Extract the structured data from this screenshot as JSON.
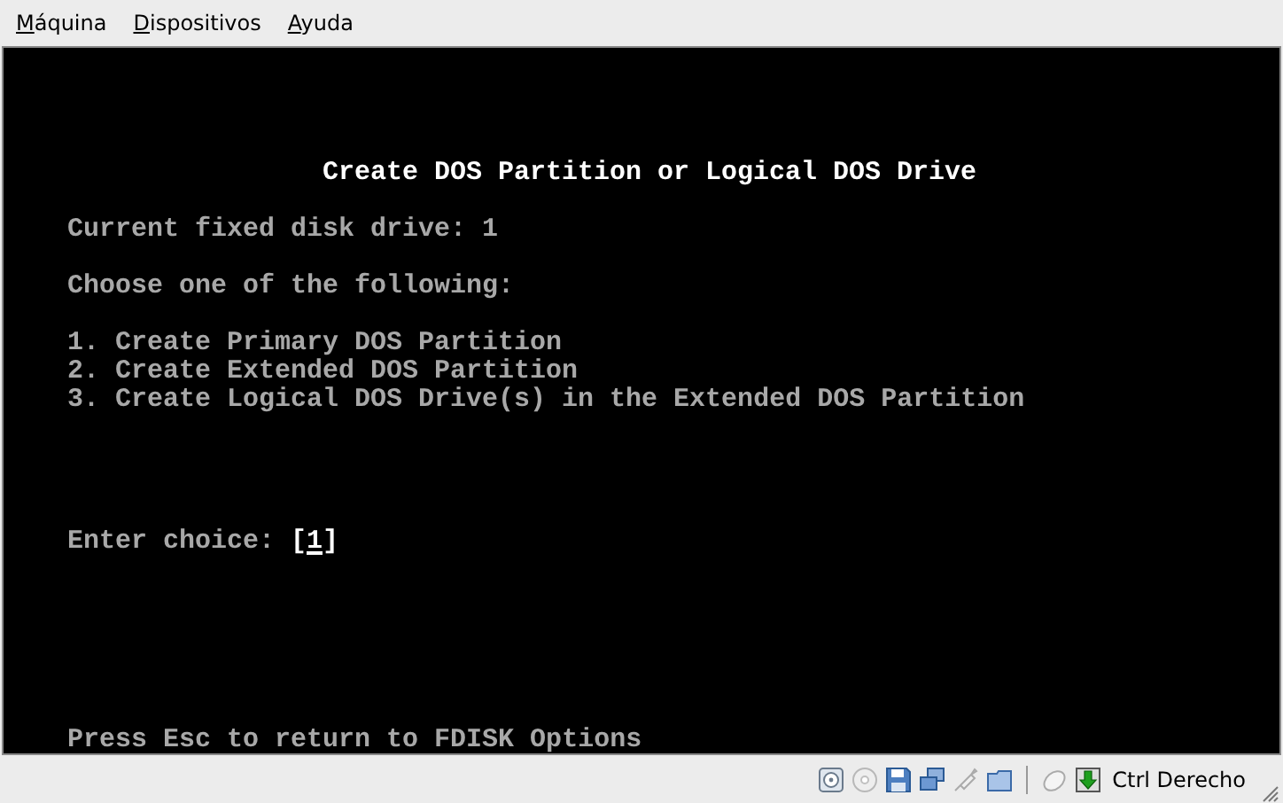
{
  "menu": [
    {
      "label": "Máquina"
    },
    {
      "label": "Dispositivos"
    },
    {
      "label": "Ayuda"
    }
  ],
  "screen": {
    "title": "Create DOS Partition or Logical DOS Drive",
    "current_drive": "Current fixed disk drive: **1**",
    "heading": "Choose one of the following:",
    "options": [
      "1. Create Primary DOS Partition",
      "2. Create Extended DOS Partition",
      "3. Create Logical DOS Drive(s) in the Extended DOS Partition"
    ],
    "prompt": "Enter choice:",
    "choice": "[1]",
    "footer": "Press **Esc** to return to FDISK Options"
  },
  "status_bar": {
    "host_key": "Ctrl Derecho"
  }
}
